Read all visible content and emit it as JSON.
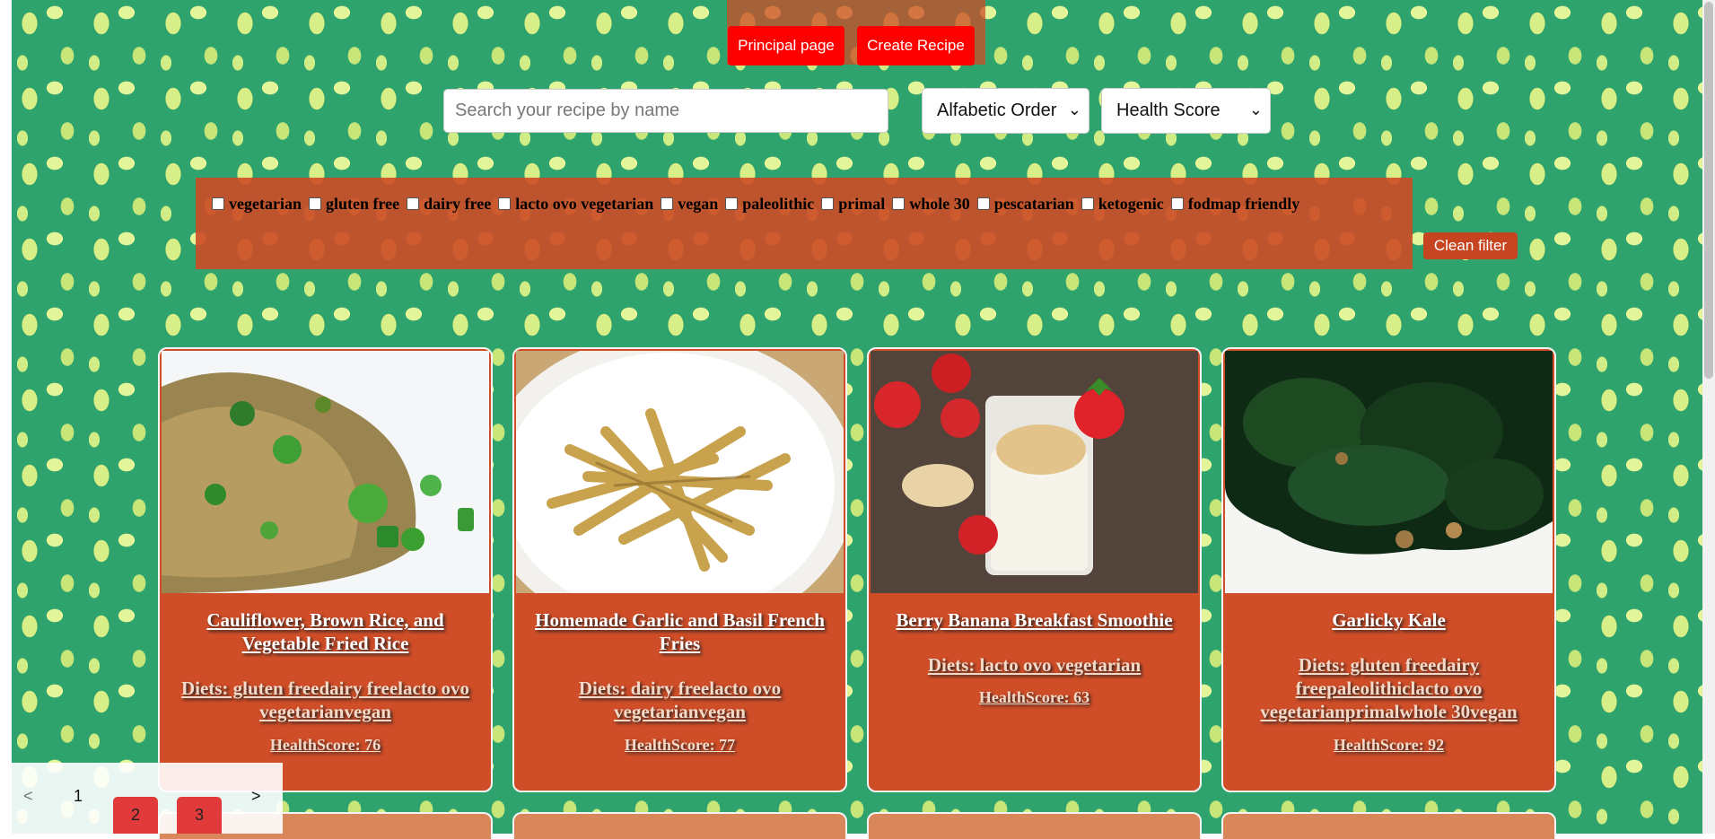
{
  "nav": {
    "principal_page": "Principal page",
    "create_recipe": "Create Recipe"
  },
  "search": {
    "placeholder": "Search your recipe by name"
  },
  "sort": {
    "order_select": "Alfabetic Order",
    "score_select": "Health Score"
  },
  "filters": {
    "diets": [
      "vegetarian",
      "gluten free",
      "dairy free",
      "lacto ovo vegetarian",
      "vegan",
      "paleolithic",
      "primal",
      "whole 30",
      "pescatarian",
      "ketogenic",
      "fodmap friendly"
    ],
    "clean_label": "Clean filter"
  },
  "recipes": [
    {
      "title": "Cauliflower, Brown Rice, and Vegetable Fried Rice",
      "diets": "Diets: gluten freedairy freelacto ovo vegetarianvegan",
      "health": "HealthScore: 76"
    },
    {
      "title": "Homemade Garlic and Basil French Fries",
      "diets": "Diets: dairy freelacto ovo vegetarianvegan",
      "health": "HealthScore: 77"
    },
    {
      "title": "Berry Banana Breakfast Smoothie",
      "diets": "Diets: lacto ovo vegetarian",
      "health": "HealthScore: 63"
    },
    {
      "title": "Garlicky Kale",
      "diets": "Diets: gluten freedairy freepaleolithiclacto ovo vegetarianprimalwhole 30vegan",
      "health": "HealthScore: 92"
    }
  ],
  "pagination": {
    "prev": "<",
    "next": ">",
    "pages": [
      "1",
      "2",
      "3"
    ]
  },
  "colors": {
    "background": "#2ea36e",
    "accent_red": "#ff0000",
    "card": "#cf4d27"
  }
}
